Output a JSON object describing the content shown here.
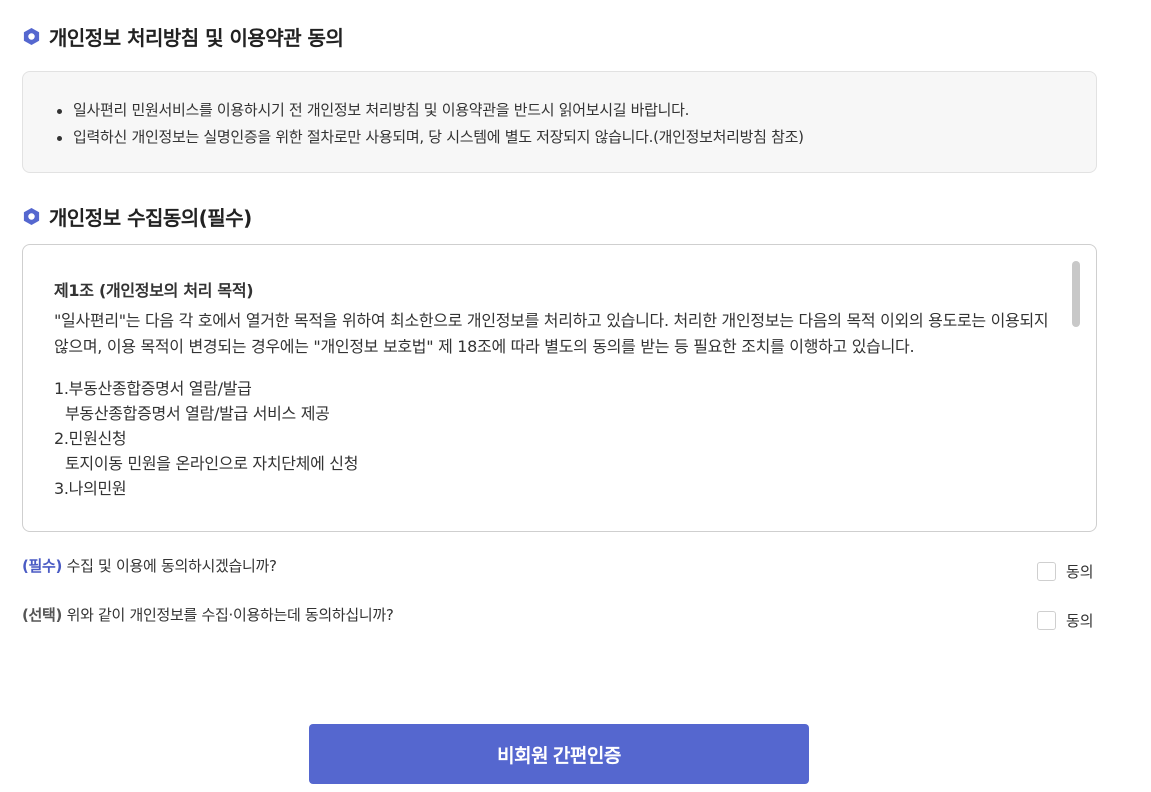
{
  "sections": {
    "privacy_title": "개인정보 처리방침 및 이용약관 동의",
    "collect_title": "개인정보 수집동의(필수)"
  },
  "notice": {
    "items": [
      "일사편리 민원서비스를 이용하시기 전 개인정보 처리방침 및 이용약관을 반드시 읽어보시길 바랍니다.",
      "입력하신 개인정보는 실명인증을 위한 절차로만 사용되며, 당 시스템에 별도 저장되지 않습니다.(개인정보처리방침 참조)"
    ]
  },
  "terms": {
    "heading": "제1조 (개인정보의 처리 목적)",
    "body": "\"일사편리\"는 다음 각 호에서 열거한 목적을 위하여 최소한으로 개인정보를 처리하고 있습니다. 처리한 개인정보는 다음의 목적 이외의 용도로는 이용되지 않으며, 이용 목적이 변경되는 경우에는 \"개인정보 보호법\" 제 18조에 따라 별도의 동의를 받는 등 필요한 조치를 이행하고 있습니다.",
    "list": [
      "1.부동산종합증명서 열람/발급",
      "부동산종합증명서 열람/발급 서비스 제공",
      "2.민원신청",
      "토지이동 민원을 온라인으로 자치단체에 신청",
      "3.나의민원"
    ]
  },
  "consent": {
    "required": {
      "tag": "(필수)",
      "question": "수집 및 이용에 동의하시겠습니까?",
      "label": "동의"
    },
    "optional": {
      "tag": "(선택)",
      "question": "위와 같이 개인정보를 수집·이용하는데 동의하십니까?",
      "label": "동의"
    }
  },
  "actions": {
    "submit_label": "비회원 간편인증"
  },
  "colors": {
    "accent": "#5567cf",
    "required_tag": "#4a5bc4"
  }
}
